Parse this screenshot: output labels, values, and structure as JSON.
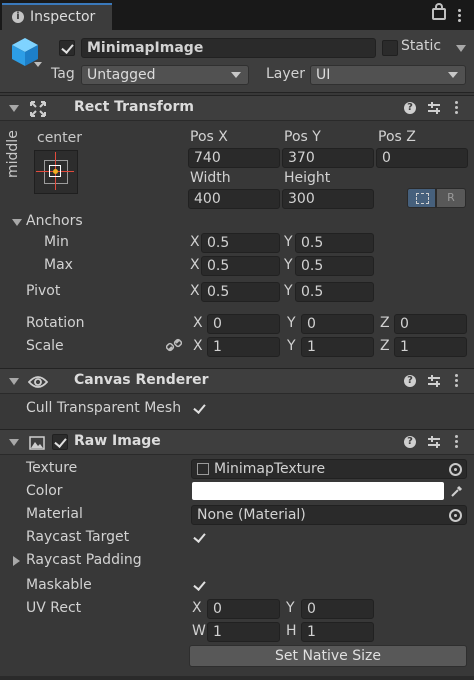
{
  "window": {
    "tab_title": "Inspector"
  },
  "gameobject": {
    "name": "MinimapImage",
    "static_label": "Static",
    "tag_label": "Tag",
    "tag_value": "Untagged",
    "layer_label": "Layer",
    "layer_value": "UI",
    "active": true,
    "static": false
  },
  "rect_transform": {
    "title": "Rect Transform",
    "anchor_preset_h": "center",
    "anchor_preset_v": "middle",
    "pos_x_label": "Pos X",
    "pos_y_label": "Pos Y",
    "pos_z_label": "Pos Z",
    "pos_x": "740",
    "pos_y": "370",
    "pos_z": "0",
    "width_label": "Width",
    "height_label": "Height",
    "width": "400",
    "height": "300",
    "anchors_label": "Anchors",
    "min_label": "Min",
    "max_label": "Max",
    "x_label": "X",
    "y_label": "Y",
    "z_label": "Z",
    "min_x": "0.5",
    "min_y": "0.5",
    "max_x": "0.5",
    "max_y": "0.5",
    "pivot_label": "Pivot",
    "pivot_x": "0.5",
    "pivot_y": "0.5",
    "rotation_label": "Rotation",
    "rot_x": "0",
    "rot_y": "0",
    "rot_z": "0",
    "scale_label": "Scale",
    "scale_x": "1",
    "scale_y": "1",
    "scale_z": "1",
    "raw_edit_glyph": "R"
  },
  "canvas_renderer": {
    "title": "Canvas Renderer",
    "cull_label": "Cull Transparent Mesh",
    "cull_checked": true
  },
  "raw_image": {
    "title": "Raw Image",
    "enabled": true,
    "texture_label": "Texture",
    "texture_value": "MinimapTexture",
    "color_label": "Color",
    "color_value": "#ffffff",
    "material_label": "Material",
    "material_value": "None (Material)",
    "raycast_target_label": "Raycast Target",
    "raycast_target_checked": true,
    "raycast_padding_label": "Raycast Padding",
    "maskable_label": "Maskable",
    "maskable_checked": true,
    "uvrect_label": "UV Rect",
    "x_label": "X",
    "y_label": "Y",
    "w_label": "W",
    "h_label": "H",
    "uv_x": "0",
    "uv_y": "0",
    "uv_w": "1",
    "uv_h": "1",
    "set_native_label": "Set Native Size"
  },
  "colors": {
    "accent": "#3a79bb",
    "background": "#383838",
    "header": "#3e3e3e",
    "field": "#2a2a2a"
  },
  "icons": [
    "info-icon",
    "lock-icon",
    "kebab-menu-icon",
    "gameobject-cube-icon",
    "rect-transform-icon",
    "help-icon",
    "presets-icon",
    "eye-icon",
    "image-icon",
    "link-icon",
    "eyedropper-icon",
    "object-picker-icon",
    "blueprint-mode-icon"
  ]
}
